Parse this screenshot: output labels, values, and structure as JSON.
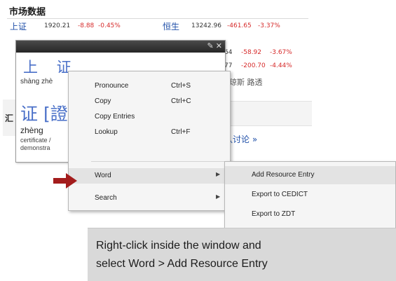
{
  "page": {
    "section_title": "市场数据",
    "market_rows": [
      {
        "name": "上证",
        "value": "1920.21",
        "change": "-8.88",
        "pct": "-0.45%",
        "name2": "恒生",
        "value2": "13242.96",
        "change2": "-461.65",
        "pct2": "-3.37%"
      },
      {
        "name": "",
        "value": "",
        "change": "",
        "pct": "",
        "name2": "",
        "value2": "64",
        "change2": "-58.92",
        "pct2": "-3.67%"
      },
      {
        "name": "",
        "value": "",
        "change": "",
        "pct": "",
        "name2": "",
        "value2": "77",
        "change2": "-200.70",
        "pct2": "-4.44%"
      }
    ],
    "bg_text": "道琼斯 路透",
    "bg_link": "认讨论 »",
    "bg_left_char": "汇"
  },
  "dict_popup": {
    "headword": "上 证",
    "pinyin": "shàng zhè",
    "char_large": "证 [證",
    "char_pinyin": "zhèng",
    "definitions": [
      "certificate /",
      "demonstra"
    ]
  },
  "context_menu": {
    "items": [
      {
        "label": "Pronounce",
        "shortcut": "Ctrl+S"
      },
      {
        "label": "Copy",
        "shortcut": "Ctrl+C"
      },
      {
        "label": "Copy Entries",
        "shortcut": ""
      },
      {
        "label": "Lookup",
        "shortcut": "Ctrl+F"
      },
      {
        "label": "Word",
        "shortcut": "",
        "submenu": true
      },
      {
        "label": "Search",
        "shortcut": "",
        "submenu": true
      }
    ],
    "arrow_glyph": "▶"
  },
  "submenu": {
    "items": [
      "Add Resource Entry",
      "Export to CEDICT",
      "Export to ZDT"
    ]
  },
  "caption": {
    "line1": "Right-click inside the window and",
    "line2": "select Word > Add Resource Entry"
  },
  "colors": {
    "index_blue": "#1f4fa8",
    "negative_red": "#d62a2a",
    "headword_blue": "#4a70c8",
    "pointer_arrow": "#a31c1c",
    "caption_bg": "#d9d9d9"
  }
}
